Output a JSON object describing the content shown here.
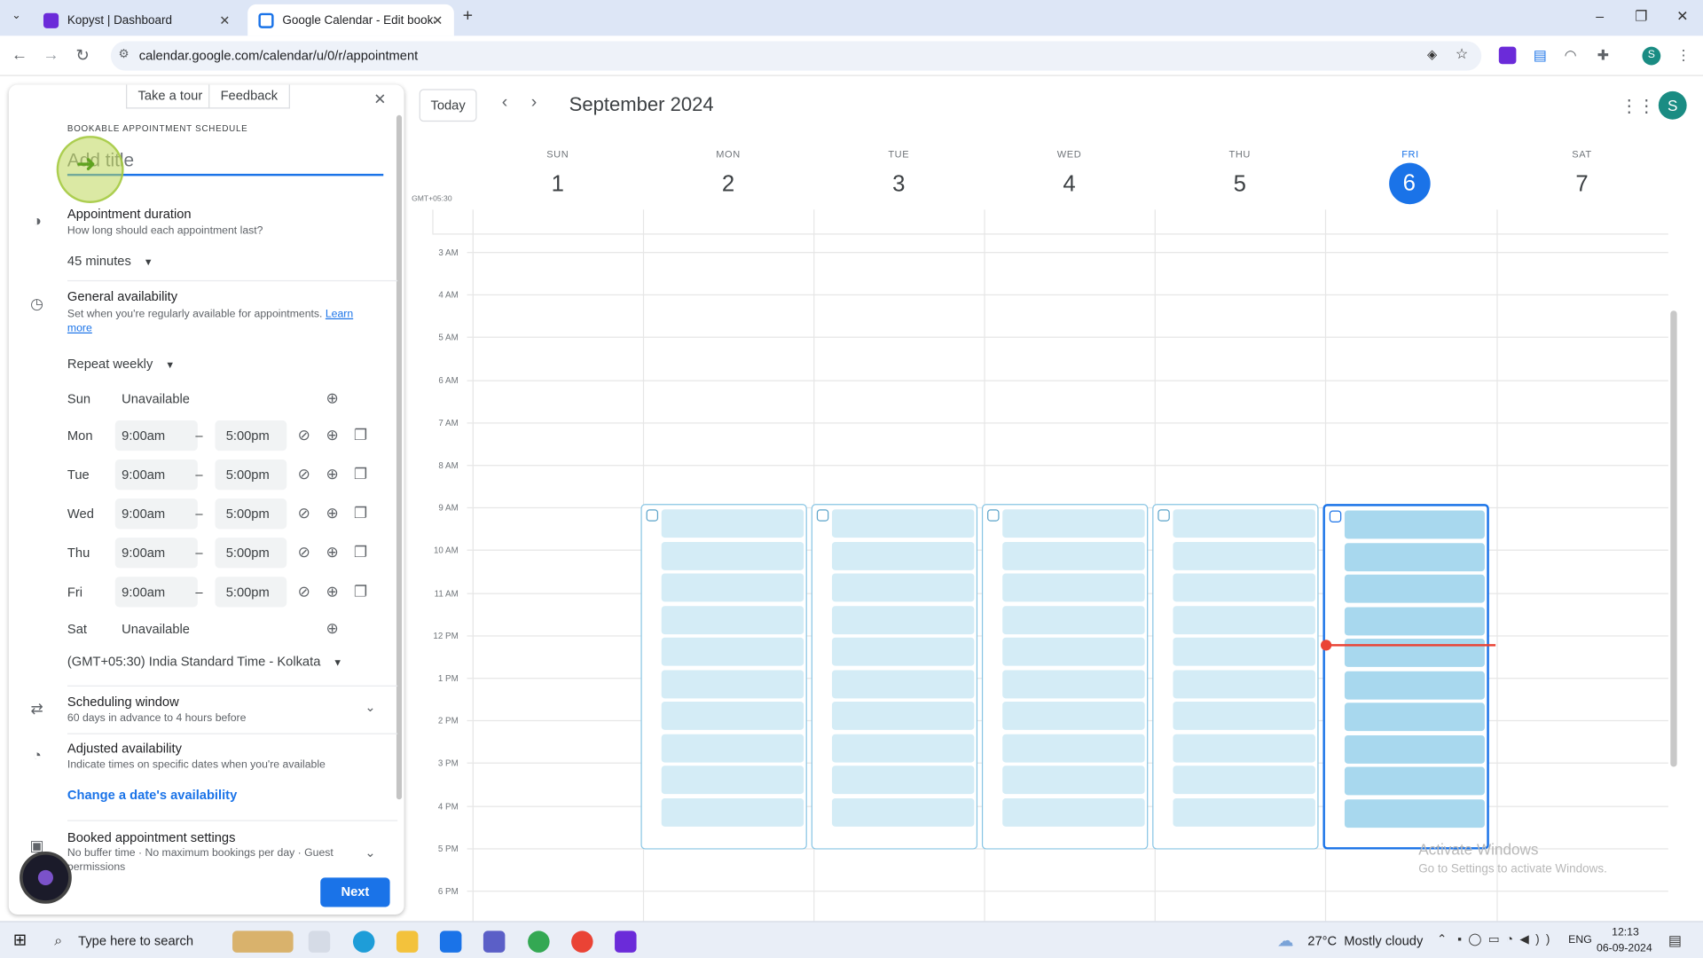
{
  "browser": {
    "tabs": [
      {
        "title": "Kopyst | Dashboard",
        "active": false,
        "favicon_color": "#6b2bd9"
      },
      {
        "title": "Google Calendar - Edit bookab",
        "active": true,
        "favicon_color": "#1a73e8"
      }
    ],
    "url": "calendar.google.com/calendar/u/0/r/appointment",
    "new_tab_icon": "plus-icon",
    "profile_initial": "S"
  },
  "panel": {
    "take_tour": "Take a tour",
    "feedback": "Feedback",
    "heading": "BOOKABLE APPOINTMENT SCHEDULE",
    "title_placeholder": "Add title",
    "duration": {
      "label": "Appointment duration",
      "sub": "How long should each appointment last?",
      "value": "45 minutes"
    },
    "availability": {
      "label": "General availability",
      "sub": "Set when you're regularly available for appointments.",
      "learn": "Learn",
      "more": "more",
      "repeat": "Repeat weekly"
    },
    "days": [
      {
        "day": "Sun",
        "unavailable": "Unavailable"
      },
      {
        "day": "Mon",
        "start": "9:00am",
        "dash": "–",
        "end": "5:00pm"
      },
      {
        "day": "Tue",
        "start": "9:00am",
        "dash": "–",
        "end": "5:00pm"
      },
      {
        "day": "Wed",
        "start": "9:00am",
        "dash": "–",
        "end": "5:00pm"
      },
      {
        "day": "Thu",
        "start": "9:00am",
        "dash": "–",
        "end": "5:00pm"
      },
      {
        "day": "Fri",
        "start": "9:00am",
        "dash": "–",
        "end": "5:00pm"
      },
      {
        "day": "Sat",
        "unavailable": "Unavailable"
      }
    ],
    "timezone": "(GMT+05:30) India Standard Time - Kolkata",
    "scheduling": {
      "label": "Scheduling window",
      "sub": "60 days in advance to 4 hours before"
    },
    "adjusted": {
      "label": "Adjusted availability",
      "sub": "Indicate times on specific dates when you're available",
      "link": "Change a date's availability"
    },
    "booked": {
      "label": "Booked appointment settings",
      "sub1": "No buffer time · No maximum bookings per day · Guest",
      "sub2": "permissions"
    },
    "next": "Next"
  },
  "calendar": {
    "today": "Today",
    "month": "September 2024",
    "timezone_label": "GMT+05:30",
    "avatar": "S",
    "accent": "#1a73e8",
    "days": [
      {
        "dow": "SUN",
        "num": "1"
      },
      {
        "dow": "MON",
        "num": "2"
      },
      {
        "dow": "TUE",
        "num": "3"
      },
      {
        "dow": "WED",
        "num": "4"
      },
      {
        "dow": "THU",
        "num": "5"
      },
      {
        "dow": "FRI",
        "num": "6",
        "today": true
      },
      {
        "dow": "SAT",
        "num": "7"
      }
    ],
    "hours": [
      "3 AM",
      "4 AM",
      "5 AM",
      "6 AM",
      "7 AM",
      "8 AM",
      "9 AM",
      "10 AM",
      "11 AM",
      "12 PM",
      "1 PM",
      "2 PM",
      "3 PM",
      "4 PM",
      "5 PM",
      "6 PM"
    ],
    "watermark1": "Activate Windows",
    "watermark2": "Go to Settings to activate Windows."
  },
  "taskbar": {
    "search": "Type here to search",
    "weather": "27°C  Mostly cloudy",
    "lang": "ENG",
    "time": "12:13",
    "date": "06-09-2024"
  }
}
